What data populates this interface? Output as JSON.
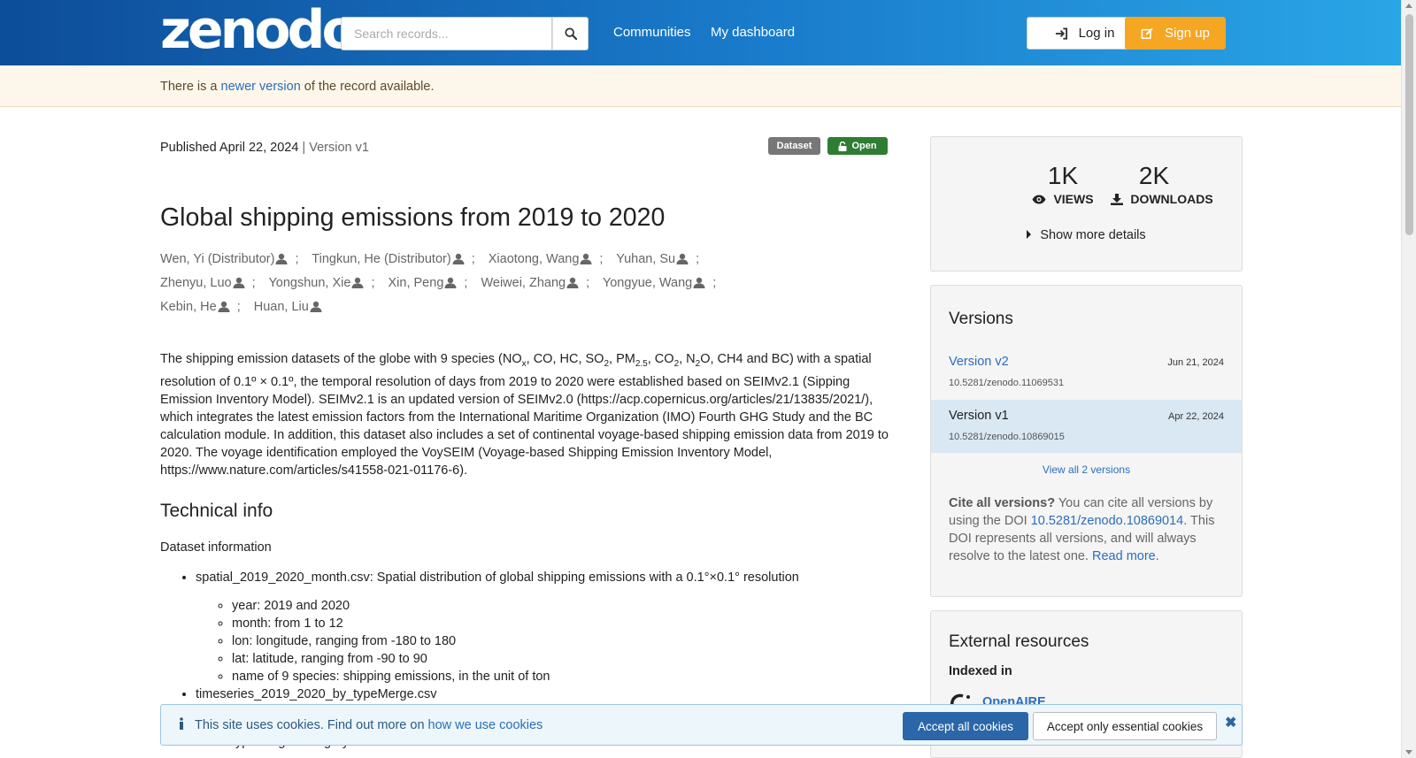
{
  "header": {
    "logo": "zenodo",
    "search_placeholder": "Search records...",
    "nav": [
      "Communities",
      "My dashboard"
    ],
    "login_label": "Log in",
    "signup_label": "Sign up"
  },
  "banner": {
    "prefix": "There is a ",
    "link": "newer version",
    "suffix": " of the record available."
  },
  "record": {
    "published": "Published April 22, 2024",
    "version_sep": " | Version v1",
    "badge_type": "Dataset",
    "badge_access": "Open",
    "title": "Global shipping emissions from 2019 to 2020",
    "authors": [
      "Wen, Yi (Distributor)",
      "Tingkun, He (Distributor)",
      "Xiaotong, Wang",
      "Yuhan, Su",
      "Zhenyu, Luo",
      "Yongshun, Xie",
      "Xin, Peng",
      "Weiwei, Zhang",
      "Yongyue, Wang",
      "Kebin, He",
      "Huan, Liu"
    ],
    "description": {
      "p1": "The shipping emission datasets of the globe with 9 species (NO",
      "sub1": "x",
      "p2": ", CO, HC, SO",
      "sub2": "2",
      "p3": ", PM",
      "sub3": "2.5",
      "p4": ", CO",
      "sub4": "2",
      "p5": ",   N",
      "sub5": "2",
      "p6": "O, CH4 and BC) with a spatial resolution of 0.1º × 0.1º, the temporal resolution of days from 2019 to 2020 were established based on SEIMv2.1 (Sipping Emission Inventory Model). SEIMv2.1 is an updated version of SEIMv2.0 (https://acp.copernicus.org/articles/21/13835/2021/), which integrates the latest emission factors from the International Maritime Organization (IMO) Fourth GHG Study and the BC calculation module. In addition, this dataset also includes a set of continental voyage-based shipping emission data from 2019 to 2020. The voyage identification employed the VoySEIM (Voyage-based Shipping Emission Inventory Model, https://www.nature.com/articles/s41558-021-01176-6)."
    },
    "tech_heading": "Technical info",
    "dataset_info": "Dataset information",
    "file1": "spatial_2019_2020_month.csv: Spatial distribution of global shipping emissions with a 0.1°×0.1° resolution",
    "file1_items": [
      "year: 2019 and 2020",
      "month: from 1 to 12",
      "lon: longitude, ranging from -180 to 180",
      "lat: latitude, ranging from -90 to 90",
      "name of 9 species: shipping emissions, in the unit of ton"
    ],
    "file2": "timeseries_2019_2020_by_typeMerge.csv",
    "file2_items_partial": [
      "typeMerge: category of vessels"
    ]
  },
  "stats": {
    "views": "1K",
    "views_label": "VIEWS",
    "downloads": "2K",
    "downloads_label": "DOWNLOADS",
    "more": "Show more details"
  },
  "versions": {
    "title": "Versions",
    "items": [
      {
        "name": "Version v2",
        "date": "Jun 21, 2024",
        "doi": "10.5281/zenodo.11069531"
      },
      {
        "name": "Version v1",
        "date": "Apr 22, 2024",
        "doi": "10.5281/zenodo.10869015"
      }
    ],
    "view_all": "View all 2 versions",
    "cite_bold": "Cite all versions?",
    "cite_text1": " You can cite all versions by using the DOI ",
    "cite_doi": "10.5281/zenodo.10869014",
    "cite_text2": ". This DOI represents all versions, and will always resolve to the latest one. ",
    "read_more": "Read more",
    "period": "."
  },
  "external": {
    "title": "External resources",
    "indexed": "Indexed in",
    "openaire": "OpenAIRE"
  },
  "cookie": {
    "text": "This site uses cookies. Find out more on ",
    "link": "how we use cookies",
    "accept_all": "Accept all cookies",
    "accept_essential": "Accept only essential cookies",
    "close": "✖"
  },
  "colors": {
    "accent": "#2a6ebb",
    "signup": "#f5a623",
    "open_badge": "#2e7d32",
    "dataset_badge": "#777777"
  }
}
